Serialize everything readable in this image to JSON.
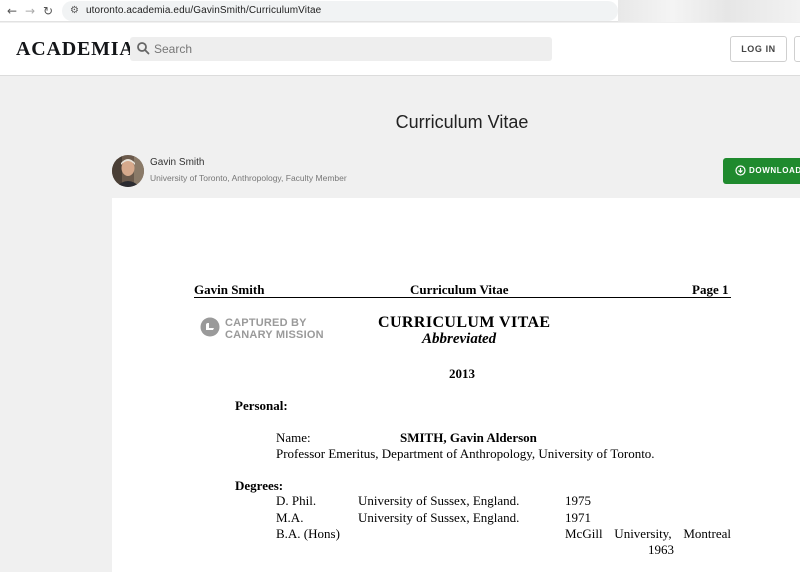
{
  "browser": {
    "url": "utoronto.academia.edu/GavinSmith/CurriculumVitae",
    "back_icon": "arrow-left-icon",
    "forward_icon": "arrow-right-icon",
    "reload_icon": "reload-icon"
  },
  "header": {
    "logo": "ACADEMIA",
    "search_placeholder": "Search",
    "login_label": "LOG IN"
  },
  "work": {
    "title": "Curriculum Vitae",
    "author_name": "Gavin Smith",
    "author_affiliation": "University of Toronto, Anthropology, Faculty Member",
    "download_label": "DOWNLOAD"
  },
  "document": {
    "running_head": {
      "name": "Gavin Smith",
      "title": "Curriculum Vitae",
      "page": "Page 1"
    },
    "stamp": {
      "line1": "CAPTURED BY",
      "line2": "CANARY MISSION"
    },
    "heading": "CURRICULUM VITAE",
    "subheading": "Abbreviated",
    "year": "2013",
    "personal": {
      "section_label": "Personal:",
      "name_label": "Name:",
      "name_value": "SMITH,  Gavin Alderson",
      "position": "Professor Emeritus, Department of Anthropology, University of Toronto."
    },
    "degrees": {
      "section_label": "Degrees:",
      "items": [
        {
          "type": "D. Phil.",
          "institution": "University of Sussex, England.",
          "year": "1975"
        },
        {
          "type": "M.A.",
          "institution": "University of Sussex, England.",
          "year": "1971"
        },
        {
          "type": "B.A. (Hons)",
          "institution": "McGill University, Montreal",
          "year": "1963"
        }
      ]
    }
  },
  "colors": {
    "download_green": "#1f8a2e",
    "page_background": "#f0f0f0",
    "stamp_gray": "#9a9a9a"
  }
}
